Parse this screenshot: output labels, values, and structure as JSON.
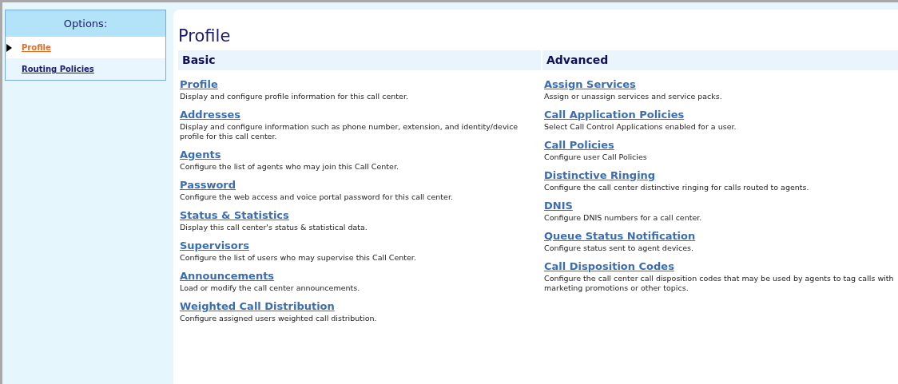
{
  "sidebar": {
    "title": "Options:",
    "items": [
      {
        "label": "Profile",
        "selected": true
      },
      {
        "label": "Routing Policies",
        "selected": false
      }
    ]
  },
  "page_title": "Profile",
  "sections": [
    {
      "title": "Basic",
      "items": [
        {
          "link": "Profile",
          "description": "Display and configure profile information for this call center."
        },
        {
          "link": "Addresses",
          "description": "Display and configure information such as phone number, extension, and identity/device profile for this call center."
        },
        {
          "link": "Agents",
          "description": "Configure the list of agents who may join this Call Center."
        },
        {
          "link": "Password",
          "description": "Configure the web access and voice portal password for this call center."
        },
        {
          "link": "Status & Statistics",
          "description": "Display this call center's status & statistical data."
        },
        {
          "link": "Supervisors",
          "description": "Configure the list of users who may supervise this Call Center."
        },
        {
          "link": "Announcements",
          "description": "Load or modify the call center announcements."
        },
        {
          "link": "Weighted Call Distribution",
          "description": "Configure assigned users weighted call distribution."
        }
      ]
    },
    {
      "title": "Advanced",
      "items": [
        {
          "link": "Assign Services",
          "description": "Assign or unassign services and service packs."
        },
        {
          "link": "Call Application Policies",
          "description": "Select Call Control Applications enabled for a user."
        },
        {
          "link": "Call Policies",
          "description": "Configure user Call Policies"
        },
        {
          "link": "Distinctive Ringing",
          "description": "Configure the call center distinctive ringing for calls routed to agents."
        },
        {
          "link": "DNIS",
          "description": "Configure DNIS numbers for a call center."
        },
        {
          "link": "Queue Status Notification",
          "description": "Configure status sent to agent devices."
        },
        {
          "link": "Call Disposition Codes",
          "description": "Configure the call center call disposition codes that may be used by agents to tag calls with marketing promotions or other topics."
        }
      ]
    }
  ]
}
